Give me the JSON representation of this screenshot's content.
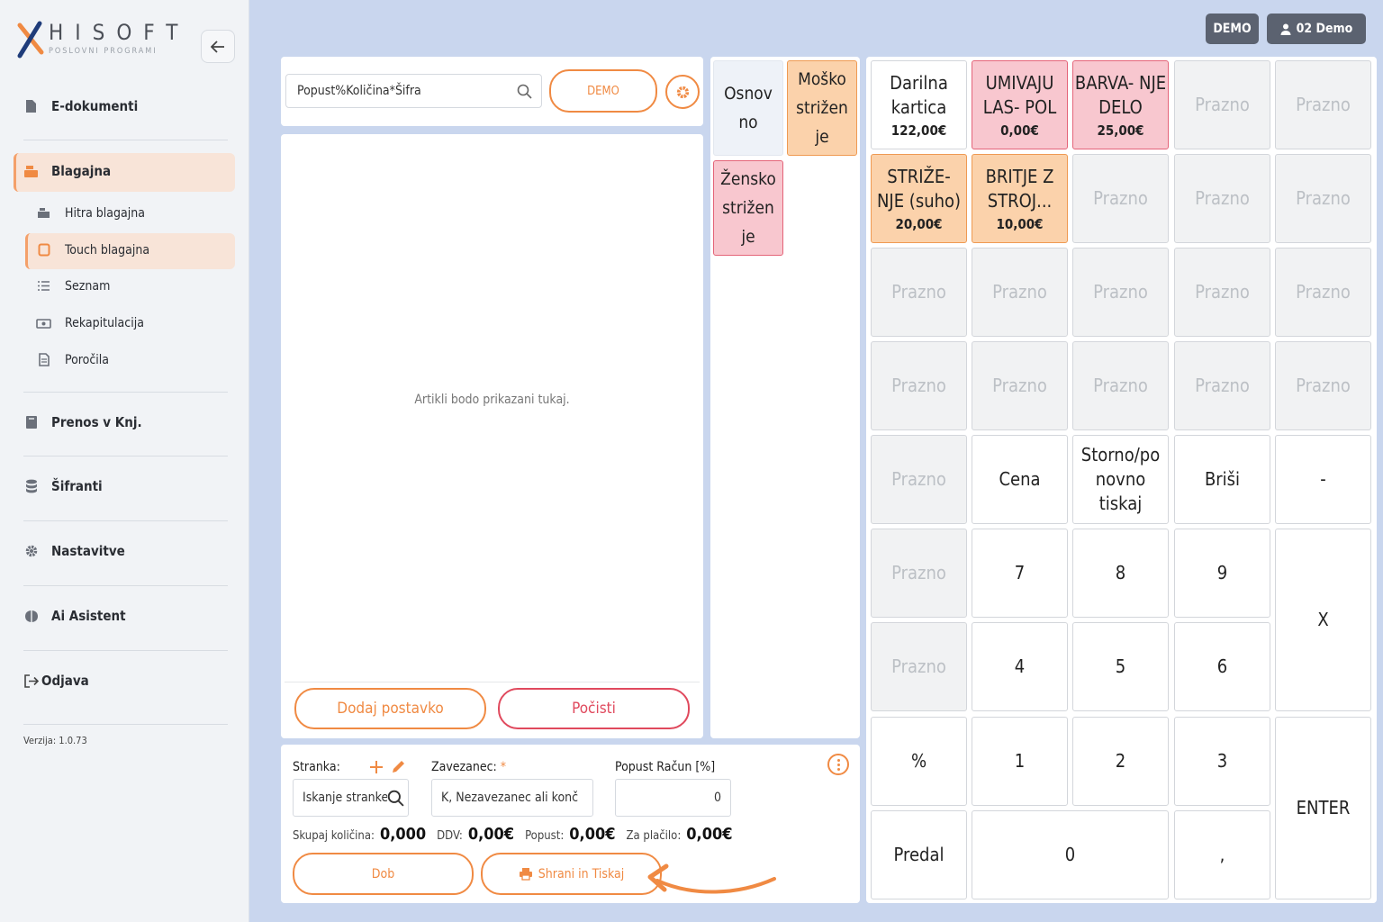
{
  "brand": {
    "name": "HISOFT",
    "tagline": "POSLOVNI PROGRAMI"
  },
  "sidebar": {
    "main_items": [
      {
        "label": "E-dokumenti",
        "icon": "document-icon"
      },
      {
        "label": "Blagajna",
        "icon": "cash-register-icon"
      },
      {
        "label": "Prenos v Knj.",
        "icon": "book-icon"
      },
      {
        "label": "Šifranti",
        "icon": "database-icon"
      },
      {
        "label": "Nastavitve",
        "icon": "gear-icon"
      },
      {
        "label": "Ai Asistent",
        "icon": "brain-icon"
      },
      {
        "label": "Odjava",
        "icon": "logout-icon"
      }
    ],
    "sub_items": [
      {
        "label": "Hitra blagajna",
        "icon": "register-icon"
      },
      {
        "label": "Touch blagajna",
        "icon": "tablet-icon"
      },
      {
        "label": "Seznam",
        "icon": "list-icon"
      },
      {
        "label": "Rekapitulacija",
        "icon": "money-icon"
      },
      {
        "label": "Poročila",
        "icon": "report-icon"
      }
    ],
    "version": "Verzija: 1.0.73"
  },
  "header": {
    "env_badge": "DEMO",
    "user_label": "02 Demo"
  },
  "toolbar": {
    "search_value": "Popust%Količina*Šifra",
    "demo_button": "DEMO"
  },
  "items_panel": {
    "empty_text": "Artikli bodo prikazani tukaj.",
    "add_button": "Dodaj postavko",
    "clear_button": "Počisti"
  },
  "categories": [
    {
      "label": "Osnov no",
      "style": "plain"
    },
    {
      "label": "Moško strižen je",
      "style": "peach"
    },
    {
      "label": "Žensko strižen je",
      "style": "pink"
    }
  ],
  "products": [
    {
      "name": "Darilna kartica",
      "price": "122,00€",
      "style": "plain"
    },
    {
      "name": "UMIVAJU LAS- POL",
      "price": "0,00€",
      "style": "pink"
    },
    {
      "name": "BARVA- NJE DELO",
      "price": "25,00€",
      "style": "pink"
    },
    {
      "name": "STRIŽE- NJE (suho)",
      "price": "20,00€",
      "style": "peach"
    },
    {
      "name": "BRITJE Z STROJ...",
      "price": "10,00€",
      "style": "peach"
    }
  ],
  "keypad": {
    "empty_label": "Prazno",
    "cena": "Cena",
    "storno": "Storno/po novno tiskaj",
    "brisi": "Briši",
    "minus": "-",
    "seven": "7",
    "eight": "8",
    "nine": "9",
    "times": "X",
    "four": "4",
    "five": "5",
    "six": "6",
    "percent": "%",
    "one": "1",
    "two": "2",
    "three": "3",
    "enter": "ENTER",
    "predal": "Predal",
    "zero": "0",
    "comma": ","
  },
  "footer_form": {
    "customer_label": "Stranka:",
    "customer_placeholder": "Iskanje stranke",
    "taxpayer_label": "Zavezanec:",
    "required_mark": "*",
    "taxpayer_value": "K, Nezavezanec ali konč",
    "discount_label": "Popust Račun [%]",
    "discount_value": "0",
    "total_qty_label": "Skupaj količina:",
    "total_qty": "0,000",
    "vat_label": "DDV:",
    "vat": "0,00€",
    "discount_total_label": "Popust:",
    "discount_total": "0,00€",
    "to_pay_label": "Za plačilo:",
    "to_pay": "0,00€",
    "dob_button": "Dob",
    "save_print_button": "Shrani in Tiskaj"
  },
  "colors": {
    "accent": "#f08a43",
    "danger": "#e0495d",
    "pink_tile": "#f8c7cf",
    "peach_tile": "#fbd2ab",
    "background": "#c9d6ee"
  }
}
